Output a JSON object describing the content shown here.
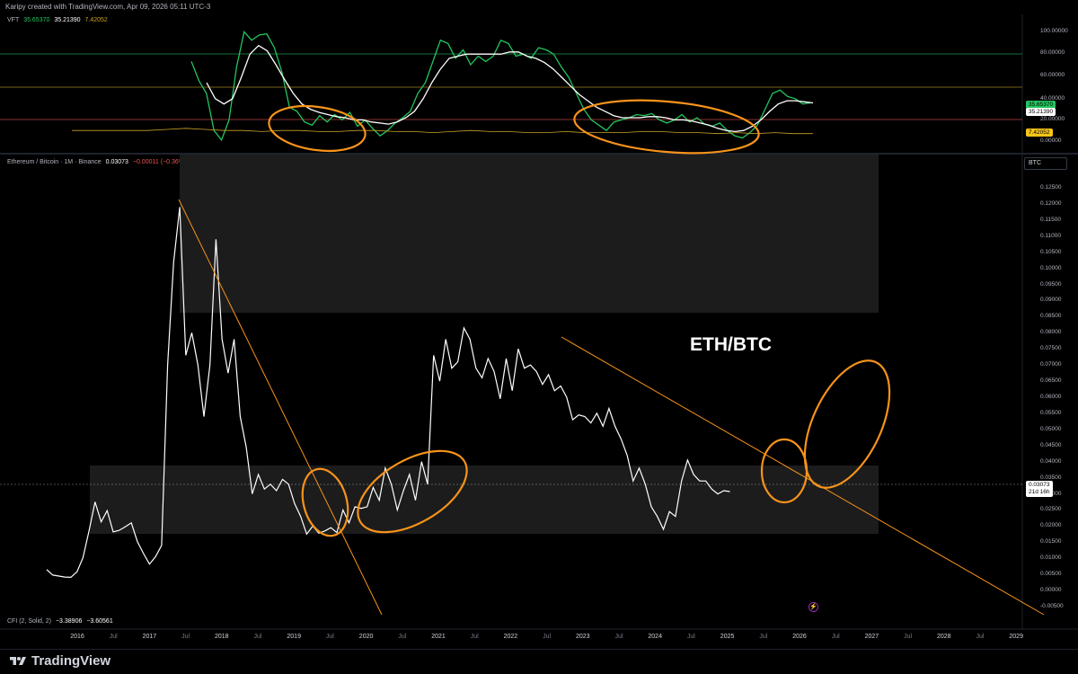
{
  "header": {
    "created_text": "Karipy created with TradingView.com, Apr 09, 2026 05:11 UTC-3"
  },
  "vft_panel": {
    "name": "VFT",
    "v1": "35.65370",
    "v2": "35.21390",
    "v3": "7.42052",
    "colors": {
      "green": "#22c55e",
      "white": "#ffffff",
      "gold": "#c9a227"
    },
    "y_ticks": [
      "100.00000",
      "80.00000",
      "60.00000",
      "40.00000",
      "20.00000",
      "0.00000"
    ],
    "badge_green": "35.65370",
    "badge_white": "35.21390",
    "badge_gold": "7.42052",
    "levels": [
      80,
      50,
      20
    ]
  },
  "main_panel": {
    "legend_symbol": "Ethereum / Bitcoin · 1M · Binance",
    "legend_price": "0.03073",
    "legend_change": "−0.00011 (−0.36%)",
    "currency": "BTC",
    "chart_label": "ETH/BTC",
    "y_ticks": [
      "0.12500",
      "0.12000",
      "0.11500",
      "0.11000",
      "0.10500",
      "0.10000",
      "0.09500",
      "0.09000",
      "0.08500",
      "0.08000",
      "0.07500",
      "0.07000",
      "0.06500",
      "0.06000",
      "0.05500",
      "0.05000",
      "0.04500",
      "0.04000",
      "0.03500",
      "0.03000",
      "0.02500",
      "0.02000",
      "0.01500",
      "0.01000",
      "0.00500",
      "0.00000",
      "-0.00500"
    ],
    "price_badge": "0.03073",
    "countdown_badge": "21d 16h"
  },
  "cfi_legend": {
    "name": "CFI (2, Solid, 2)",
    "v1": "−3.38906",
    "v2": "−3.60561"
  },
  "x_axis": [
    {
      "label": "2016",
      "kind": "year"
    },
    {
      "label": "Jul",
      "kind": "month"
    },
    {
      "label": "2017",
      "kind": "year"
    },
    {
      "label": "Jul",
      "kind": "month"
    },
    {
      "label": "2018",
      "kind": "year"
    },
    {
      "label": "Jul",
      "kind": "month"
    },
    {
      "label": "2019",
      "kind": "year"
    },
    {
      "label": "Jul",
      "kind": "month"
    },
    {
      "label": "2020",
      "kind": "year"
    },
    {
      "label": "Jul",
      "kind": "month"
    },
    {
      "label": "2021",
      "kind": "year"
    },
    {
      "label": "Jul",
      "kind": "month"
    },
    {
      "label": "2022",
      "kind": "year"
    },
    {
      "label": "Jul",
      "kind": "month"
    },
    {
      "label": "2023",
      "kind": "year"
    },
    {
      "label": "Jul",
      "kind": "month"
    },
    {
      "label": "2024",
      "kind": "year"
    },
    {
      "label": "Jul",
      "kind": "month"
    },
    {
      "label": "2025",
      "kind": "year"
    },
    {
      "label": "Jul",
      "kind": "month"
    },
    {
      "label": "2026",
      "kind": "year"
    },
    {
      "label": "Jul",
      "kind": "month"
    },
    {
      "label": "2027",
      "kind": "year"
    },
    {
      "label": "Jul",
      "kind": "month"
    },
    {
      "label": "2028",
      "kind": "year"
    },
    {
      "label": "Jul",
      "kind": "month"
    },
    {
      "label": "2029",
      "kind": "year"
    }
  ],
  "footer": {
    "brand": "TradingView"
  },
  "chart_data": {
    "type": "line",
    "start": "2015-08",
    "interval": "1M",
    "ylim": [
      -0.0075,
      0.1275
    ],
    "series": [
      {
        "name": "Ethereum / Bitcoin",
        "values": [
          0.0065,
          0.0048,
          0.0045,
          0.0042,
          0.0041,
          0.0058,
          0.0102,
          0.0185,
          0.0275,
          0.0213,
          0.0248,
          0.0182,
          0.0187,
          0.0198,
          0.021,
          0.0152,
          0.0115,
          0.0082,
          0.0105,
          0.014,
          0.07,
          0.102,
          0.119,
          0.073,
          0.08,
          0.07,
          0.054,
          0.07,
          0.109,
          0.078,
          0.0675,
          0.078,
          0.054,
          0.0445,
          0.03,
          0.036,
          0.0315,
          0.033,
          0.031,
          0.0345,
          0.033,
          0.027,
          0.023,
          0.0175,
          0.02,
          0.0178,
          0.0185,
          0.0195,
          0.018,
          0.025,
          0.021,
          0.026,
          0.0255,
          0.026,
          0.032,
          0.028,
          0.038,
          0.033,
          0.025,
          0.031,
          0.036,
          0.028,
          0.04,
          0.033,
          0.073,
          0.065,
          0.078,
          0.069,
          0.071,
          0.0815,
          0.078,
          0.069,
          0.066,
          0.072,
          0.068,
          0.0595,
          0.072,
          0.062,
          0.075,
          0.069,
          0.07,
          0.068,
          0.064,
          0.067,
          0.062,
          0.0635,
          0.06,
          0.053,
          0.0545,
          0.054,
          0.052,
          0.055,
          0.051,
          0.0565,
          0.051,
          0.047,
          0.042,
          0.034,
          0.038,
          0.033,
          0.026,
          0.023,
          0.019,
          0.0245,
          0.023,
          0.034,
          0.0405,
          0.036,
          0.034,
          0.034,
          0.0315,
          0.03,
          0.031,
          0.0307
        ]
      }
    ],
    "vft_series": [
      {
        "name": "VFT green",
        "values": [
          75,
          57,
          45,
          10,
          1,
          20,
          70,
          103,
          95,
          100,
          101,
          88,
          65,
          32,
          28,
          18,
          15,
          24,
          18,
          25,
          20,
          27,
          14,
          20,
          12,
          5,
          10,
          17,
          22,
          28,
          45,
          55,
          75,
          95,
          92,
          78,
          86,
          72,
          80,
          75,
          80,
          95,
          92,
          80,
          82,
          78,
          88,
          86,
          82,
          70,
          60,
          45,
          30,
          20,
          15,
          10,
          18,
          20,
          22,
          25,
          24,
          26,
          20,
          17,
          20,
          25,
          18,
          22,
          16,
          14,
          17,
          10,
          5,
          3,
          8,
          15,
          30,
          45,
          48,
          42,
          40,
          35,
          36
        ]
      },
      {
        "name": "VFT white",
        "values": [
          55,
          40,
          35,
          40,
          60,
          82,
          90,
          85,
          72,
          58,
          45,
          35,
          30,
          27,
          25,
          23,
          22,
          20,
          20,
          18,
          17,
          16,
          18,
          22,
          28,
          40,
          55,
          68,
          78,
          80,
          82,
          82,
          82,
          82,
          82,
          84,
          84,
          80,
          78,
          74,
          68,
          60,
          52,
          44,
          38,
          32,
          28,
          24,
          22,
          22,
          22,
          23,
          23,
          22,
          20,
          20,
          19,
          17,
          15,
          12,
          10,
          9,
          10,
          14,
          20,
          28,
          35,
          38,
          38,
          37,
          36
        ]
      },
      {
        "name": "VFT gold",
        "values": [
          10,
          10,
          10,
          10,
          10,
          11,
          12,
          11,
          10,
          10,
          9,
          10,
          10,
          9,
          9,
          10,
          10,
          9,
          9,
          8,
          9,
          10,
          9,
          9,
          8,
          8,
          9,
          8,
          8,
          8,
          9,
          9,
          8,
          8,
          7,
          8,
          7,
          8,
          7,
          7
        ]
      }
    ],
    "annotations": [
      {
        "type": "trendline",
        "from": [
          "2017-06",
          0.119
        ],
        "to": [
          "2020-02",
          -0.0075
        ]
      },
      {
        "type": "trendline",
        "from": [
          "2022-08",
          0.077
        ],
        "to": [
          "2029-12",
          -0.0075
        ]
      },
      {
        "type": "zone",
        "from_y": 0.0155,
        "to_y": 0.0365
      },
      {
        "type": "zone",
        "from_y": 0.085,
        "to_y": 0.1275
      },
      {
        "type": "ellipse",
        "label": ""
      }
    ]
  }
}
